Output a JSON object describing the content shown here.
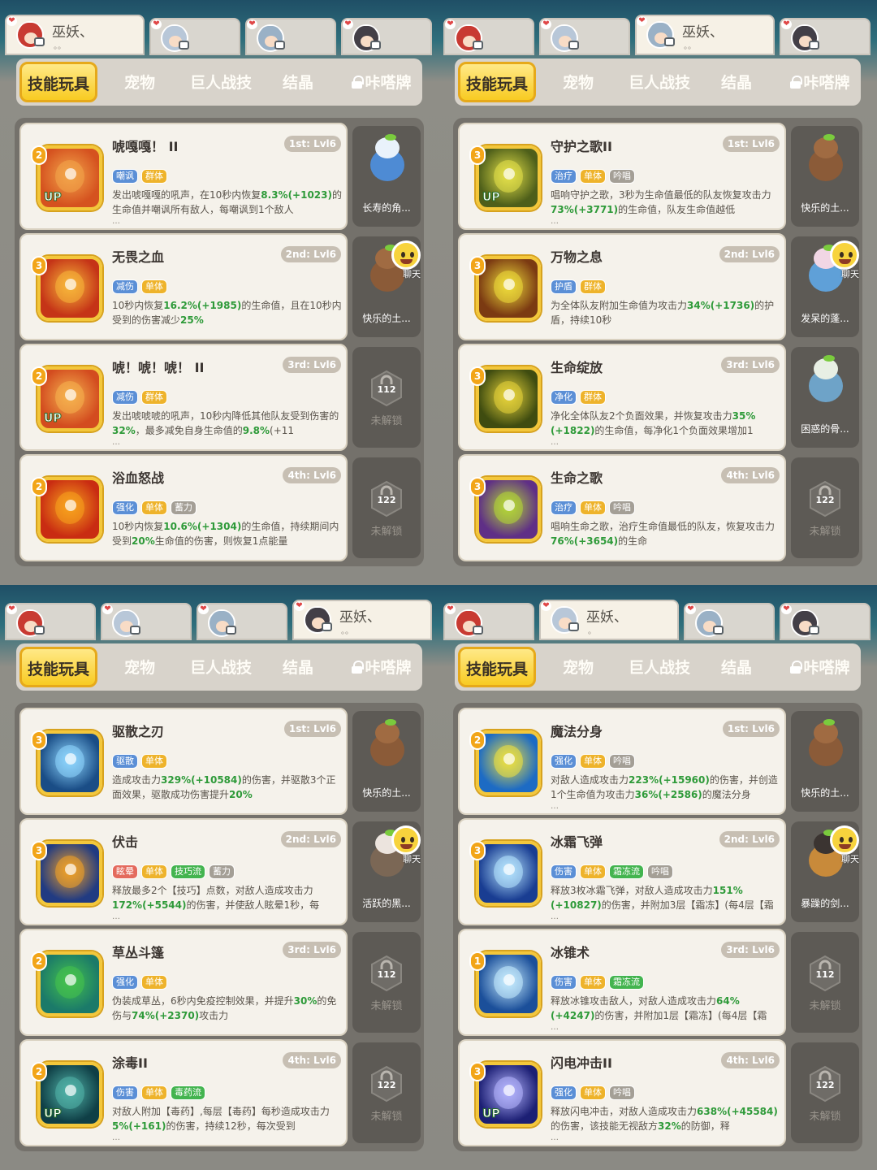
{
  "tabs": [
    "技能玩具",
    "宠物",
    "巨人战技",
    "结晶",
    "咔嗒牌"
  ],
  "active_tab": "技能玩具",
  "chat_label": "聊天",
  "icons": [
    "heart-icon",
    "chat-bubble-icon",
    "lock-icon",
    "emoji-face-icon",
    "lock-hexagon-icon"
  ],
  "panels": [
    {
      "characters": [
        {
          "name": "巫妖、",
          "dots": "。。",
          "active": true,
          "hair": "#c83a32"
        },
        {
          "name": "",
          "dots": "",
          "active": false,
          "hair": "#b8c7d8"
        },
        {
          "name": "",
          "dots": "",
          "active": false,
          "hair": "#9ab1c6"
        },
        {
          "name": "",
          "dots": "",
          "active": false,
          "hair": "#433f47"
        }
      ],
      "skills": [
        {
          "rank": "2",
          "name": "唬嘎嘎！ II",
          "slot": "1st: Lvl6",
          "up": "UP",
          "tags": [
            {
              "t": "嘲讽",
              "c": "blue"
            },
            {
              "t": "群体",
              "c": "gold"
            }
          ],
          "desc": "发出唬嘎嘎的吼声，在10秒内恢复8.3%(+1023)的生命值并嘲讽所有敌人，每嘲讽到1个敌人",
          "more": "…",
          "pet": {
            "name": "长寿的角...",
            "color": "#4e8bd4",
            "head": "#e9f2fb"
          },
          "colors": [
            "#d5521f",
            "#f3a64b"
          ]
        },
        {
          "rank": "3",
          "name": "无畏之血",
          "slot": "2nd: Lvl6",
          "up": "",
          "tags": [
            {
              "t": "减伤",
              "c": "blue"
            },
            {
              "t": "单体",
              "c": "gold"
            }
          ],
          "desc": "10秒内恢复16.2%(+1985)的生命值，且在10秒内受到的伤害减少25%",
          "more": "",
          "pet": {
            "name": "快乐的土...",
            "color": "#8b5b38",
            "head": "#a06b42"
          },
          "colors": [
            "#c53417",
            "#f7b73a"
          ]
        },
        {
          "rank": "2",
          "name": "唬！唬！唬！ II",
          "slot": "3rd: Lvl6",
          "up": "UP",
          "tags": [
            {
              "t": "减伤",
              "c": "blue"
            },
            {
              "t": "群体",
              "c": "gold"
            }
          ],
          "desc": "发出唬唬唬的吼声，10秒内降低其他队友受到伤害的32%，最多减免自身生命值的9.8%(+11",
          "more": "…",
          "lock": {
            "num": "112",
            "text": "未解锁"
          },
          "colors": [
            "#d34c1f",
            "#f5b24f"
          ]
        },
        {
          "rank": "2",
          "name": "浴血怒战",
          "slot": "4th: Lvl6",
          "up": "",
          "tags": [
            {
              "t": "强化",
              "c": "blue"
            },
            {
              "t": "单体",
              "c": "gold"
            },
            {
              "t": "蓄力",
              "c": "gray"
            }
          ],
          "desc": "10秒内恢复10.6%(+1304)的生命值，持续期间内受到20%生命值的伤害，则恢复1点能量",
          "more": "",
          "lock": {
            "num": "122",
            "text": "未解锁"
          },
          "colors": [
            "#c92c12",
            "#f7a31d"
          ]
        }
      ]
    },
    {
      "characters": [
        {
          "name": "",
          "dots": "",
          "active": false,
          "hair": "#c83a32"
        },
        {
          "name": "",
          "dots": "",
          "active": false,
          "hair": "#b8c7d8"
        },
        {
          "name": "巫妖、",
          "dots": "。。",
          "active": true,
          "hair": "#9ab1c6"
        },
        {
          "name": "",
          "dots": "",
          "active": false,
          "hair": "#433f47"
        }
      ],
      "skills": [
        {
          "rank": "3",
          "name": "守护之歌II",
          "slot": "1st: Lvl6",
          "up": "UP",
          "tags": [
            {
              "t": "治疗",
              "c": "blue"
            },
            {
              "t": "单体",
              "c": "gold"
            },
            {
              "t": "吟唱",
              "c": "gray"
            }
          ],
          "desc": "唱响守护之歌，3秒为生命值最低的队友恢复攻击力73%(+3771)的生命值，队友生命值越低",
          "more": "…",
          "pet": {
            "name": "快乐的土...",
            "color": "#8b5b38",
            "head": "#a06b42"
          },
          "colors": [
            "#4e5f1a",
            "#e6e24a"
          ]
        },
        {
          "rank": "3",
          "name": "万物之息",
          "slot": "2nd: Lvl6",
          "up": "",
          "tags": [
            {
              "t": "护盾",
              "c": "blue"
            },
            {
              "t": "群体",
              "c": "gold"
            }
          ],
          "desc": "为全体队友附加生命值为攻击力34%(+1736)的护盾，持续10秒",
          "more": "",
          "pet": {
            "name": "发呆的蓬...",
            "color": "#5fa0d8",
            "head": "#f1d6e4"
          },
          "colors": [
            "#7b3a12",
            "#efdd3b"
          ]
        },
        {
          "rank": "3",
          "name": "生命绽放",
          "slot": "3rd: Lvl6",
          "up": "",
          "tags": [
            {
              "t": "净化",
              "c": "blue"
            },
            {
              "t": "群体",
              "c": "gold"
            }
          ],
          "desc": "净化全体队友2个负面效果，并恢复攻击力35%(+1822)的生命值，每净化1个负面效果增加1",
          "more": "…",
          "pet": {
            "name": "困惑的骨...",
            "color": "#6ea3c8",
            "head": "#e8efe4"
          },
          "colors": [
            "#3f4c10",
            "#e7d33a"
          ]
        },
        {
          "rank": "3",
          "name": "生命之歌",
          "slot": "4th: Lvl6",
          "up": "",
          "tags": [
            {
              "t": "治疗",
              "c": "blue"
            },
            {
              "t": "单体",
              "c": "gold"
            },
            {
              "t": "吟唱",
              "c": "gray"
            }
          ],
          "desc": "唱响生命之歌，治疗生命值最低的队友，恢复攻击力76%(+3654)的生命",
          "more": "",
          "lock": {
            "num": "122",
            "text": "未解锁"
          },
          "colors": [
            "#5f2f86",
            "#b4d935"
          ]
        }
      ]
    },
    {
      "characters": [
        {
          "name": "",
          "dots": "",
          "active": false,
          "hair": "#c83a32"
        },
        {
          "name": "",
          "dots": "",
          "active": false,
          "hair": "#b8c7d8"
        },
        {
          "name": "",
          "dots": "",
          "active": false,
          "hair": "#9ab1c6"
        },
        {
          "name": "巫妖、",
          "dots": "。。",
          "active": true,
          "hair": "#433f47"
        }
      ],
      "skills": [
        {
          "rank": "3",
          "name": "驱散之刃",
          "slot": "1st: Lvl6",
          "up": "",
          "tags": [
            {
              "t": "驱散",
              "c": "blue"
            },
            {
              "t": "单体",
              "c": "gold"
            }
          ],
          "desc": "造成攻击力329%(+10584)的伤害，并驱散3个正面效果，驱散成功伤害提升20%",
          "more": "",
          "pet": {
            "name": "快乐的土...",
            "color": "#8b5b38",
            "head": "#a06b42"
          },
          "colors": [
            "#1a4d86",
            "#8fd7ff"
          ]
        },
        {
          "rank": "3",
          "name": "伏击",
          "slot": "2nd: Lvl6",
          "up": "",
          "tags": [
            {
              "t": "眩晕",
              "c": "red"
            },
            {
              "t": "单体",
              "c": "gold"
            },
            {
              "t": "技巧流",
              "c": "green"
            },
            {
              "t": "蓄力",
              "c": "gray"
            }
          ],
          "desc": "释放最多2个【技巧】点数，对敌人造成攻击力172%(+5544)的伤害，并使敌人眩晕1秒，每",
          "more": "…",
          "pet": {
            "name": "活跃的黑...",
            "color": "#7b6755",
            "head": "#ece4de"
          },
          "colors": [
            "#213b82",
            "#f3a226"
          ]
        },
        {
          "rank": "2",
          "name": "草丛斗篷",
          "slot": "3rd: Lvl6",
          "up": "",
          "tags": [
            {
              "t": "强化",
              "c": "blue"
            },
            {
              "t": "单体",
              "c": "gold"
            }
          ],
          "desc": "伪装成草丛，6秒内免疫控制效果，并提升30%的免伤与74%(+2370)攻击力",
          "more": "",
          "lock": {
            "num": "112",
            "text": "未解锁"
          },
          "colors": [
            "#1b7a69",
            "#45c24d"
          ]
        },
        {
          "rank": "2",
          "name": "涂毒II",
          "slot": "4th: Lvl6",
          "up": "UP",
          "tags": [
            {
              "t": "伤害",
              "c": "blue"
            },
            {
              "t": "单体",
              "c": "gold"
            },
            {
              "t": "毒药流",
              "c": "green"
            }
          ],
          "desc": "对敌人附加【毒药】,每层【毒药】每秒造成攻击力5%(+161)的伤害，持续12秒，每次受到",
          "more": "…",
          "lock": {
            "num": "122",
            "text": "未解锁"
          },
          "colors": [
            "#0f3f46",
            "#52b4a9"
          ]
        }
      ]
    },
    {
      "characters": [
        {
          "name": "",
          "dots": "",
          "active": false,
          "hair": "#c83a32"
        },
        {
          "name": "巫妖、",
          "dots": "。",
          "active": true,
          "hair": "#b8c7d8"
        },
        {
          "name": "",
          "dots": "",
          "active": false,
          "hair": "#9ab1c6"
        },
        {
          "name": "",
          "dots": "",
          "active": false,
          "hair": "#433f47"
        }
      ],
      "skills": [
        {
          "rank": "2",
          "name": "魔法分身",
          "slot": "1st: Lvl6",
          "up": "",
          "tags": [
            {
              "t": "强化",
              "c": "blue"
            },
            {
              "t": "单体",
              "c": "gold"
            },
            {
              "t": "吟唱",
              "c": "gray"
            }
          ],
          "desc": "对敌人造成攻击力223%(+15960)的伤害，并创造1个生命值为攻击力36%(+2586)的魔法分身",
          "more": "…",
          "pet": {
            "name": "快乐的土...",
            "color": "#8b5b38",
            "head": "#a06b42"
          },
          "colors": [
            "#1d6bc4",
            "#f0e13e"
          ]
        },
        {
          "rank": "3",
          "name": "冰霜飞弹",
          "slot": "2nd: Lvl6",
          "up": "",
          "tags": [
            {
              "t": "伤害",
              "c": "blue"
            },
            {
              "t": "单体",
              "c": "gold"
            },
            {
              "t": "霜冻流",
              "c": "green"
            },
            {
              "t": "吟唱",
              "c": "gray"
            }
          ],
          "desc": "释放3枚冰霜飞弹，对敌人造成攻击力151%(+10827)的伤害，并附加3层【霜冻】(每4层【霜",
          "more": "…",
          "pet": {
            "name": "暴躁的剑...",
            "color": "#c88a3a",
            "head": "#3b3431"
          },
          "colors": [
            "#193d92",
            "#b7e6ff"
          ]
        },
        {
          "rank": "1",
          "name": "冰锥术",
          "slot": "3rd: Lvl6",
          "up": "",
          "tags": [
            {
              "t": "伤害",
              "c": "blue"
            },
            {
              "t": "单体",
              "c": "gold"
            },
            {
              "t": "霜冻流",
              "c": "green"
            }
          ],
          "desc": "释放冰锥攻击敌人，对敌人造成攻击力64%(+4247)的伤害，并附加1层【霜冻】(每4层【霜",
          "more": "…",
          "lock": {
            "num": "112",
            "text": "未解锁"
          },
          "colors": [
            "#1b4f9a",
            "#c6ecff"
          ]
        },
        {
          "rank": "3",
          "name": "闪电冲击II",
          "slot": "4th: Lvl6",
          "up": "UP",
          "tags": [
            {
              "t": "强化",
              "c": "blue"
            },
            {
              "t": "单体",
              "c": "gold"
            },
            {
              "t": "吟唱",
              "c": "gray"
            }
          ],
          "desc": "释放闪电冲击，对敌人造成攻击力638%(+45584)的伤害，该技能无视敌方32%的防御，释",
          "more": "…",
          "lock": {
            "num": "122",
            "text": "未解锁"
          },
          "colors": [
            "#1c1f74",
            "#b6b6ff"
          ]
        }
      ]
    }
  ]
}
